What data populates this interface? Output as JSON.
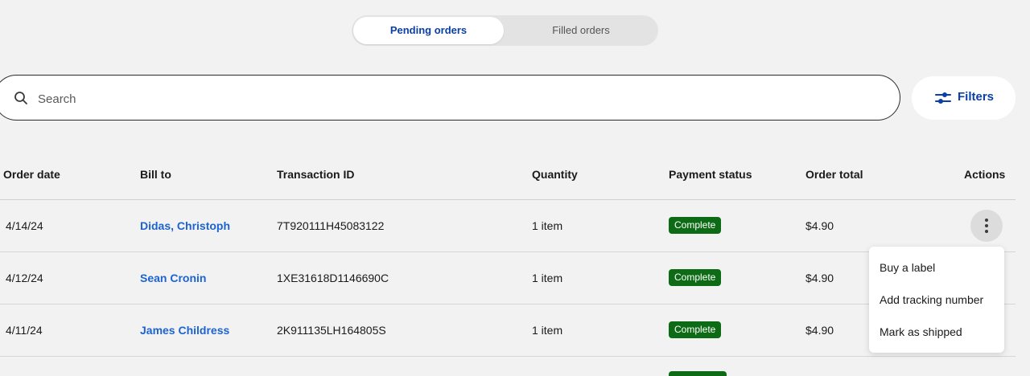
{
  "tabs": [
    {
      "label": "Pending orders",
      "active": true
    },
    {
      "label": "Filled orders",
      "active": false
    }
  ],
  "search": {
    "placeholder": "Search",
    "value": "",
    "icon": "search-icon"
  },
  "filters": {
    "label": "Filters",
    "icon": "sliders-icon"
  },
  "table": {
    "headers": {
      "order_date": "Order date",
      "bill_to": "Bill to",
      "transaction_id": "Transaction ID",
      "quantity": "Quantity",
      "payment_status": "Payment status",
      "order_total": "Order total",
      "actions": "Actions"
    },
    "rows": [
      {
        "order_date": "4/14/24",
        "bill_to": "Didas, Christoph",
        "transaction_id": "7T920111H45083122",
        "quantity": "1 item",
        "payment_status": "Complete",
        "order_total": "$4.90"
      },
      {
        "order_date": "4/12/24",
        "bill_to": "Sean Cronin",
        "transaction_id": "1XE31618D1146690C",
        "quantity": "1 item",
        "payment_status": "Complete",
        "order_total": "$4.90"
      },
      {
        "order_date": "4/11/24",
        "bill_to": "James Childress",
        "transaction_id": "2K911135LH164805S",
        "quantity": "1 item",
        "payment_status": "Complete",
        "order_total": "$4.90"
      }
    ]
  },
  "actions_menu": {
    "items": [
      "Buy a label",
      "Add tracking number",
      "Mark as shipped"
    ]
  },
  "colors": {
    "accent": "#0a3fa8",
    "link": "#1c63d1",
    "status_complete": "#0d6b16",
    "background": "#f2f2f2"
  }
}
